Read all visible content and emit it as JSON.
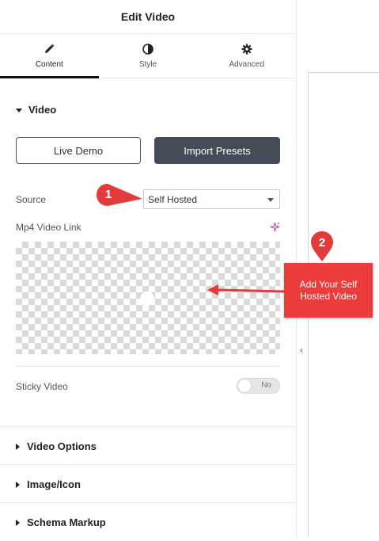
{
  "header": {
    "title": "Edit Video"
  },
  "tabs": [
    {
      "label": "Content",
      "icon": "pencil-icon"
    },
    {
      "label": "Style",
      "icon": "contrast-icon"
    },
    {
      "label": "Advanced",
      "icon": "gear-icon"
    }
  ],
  "video_section": {
    "title": "Video",
    "live_demo": "Live Demo",
    "import_presets": "Import Presets",
    "source_label": "Source",
    "source_value": "Self Hosted",
    "mp4_label": "Mp4 Video Link",
    "sticky_label": "Sticky Video",
    "sticky_toggle": "No"
  },
  "sections": [
    {
      "title": "Video Options"
    },
    {
      "title": "Image/Icon"
    },
    {
      "title": "Schema Markup"
    }
  ],
  "annotations": {
    "marker1": "1",
    "marker2": "2",
    "callout": "Add Your Self Hosted Video"
  },
  "colors": {
    "accent_red": "#ee3b3b",
    "dark_button": "#454c55",
    "ai_sparkle": "#c036c0"
  }
}
